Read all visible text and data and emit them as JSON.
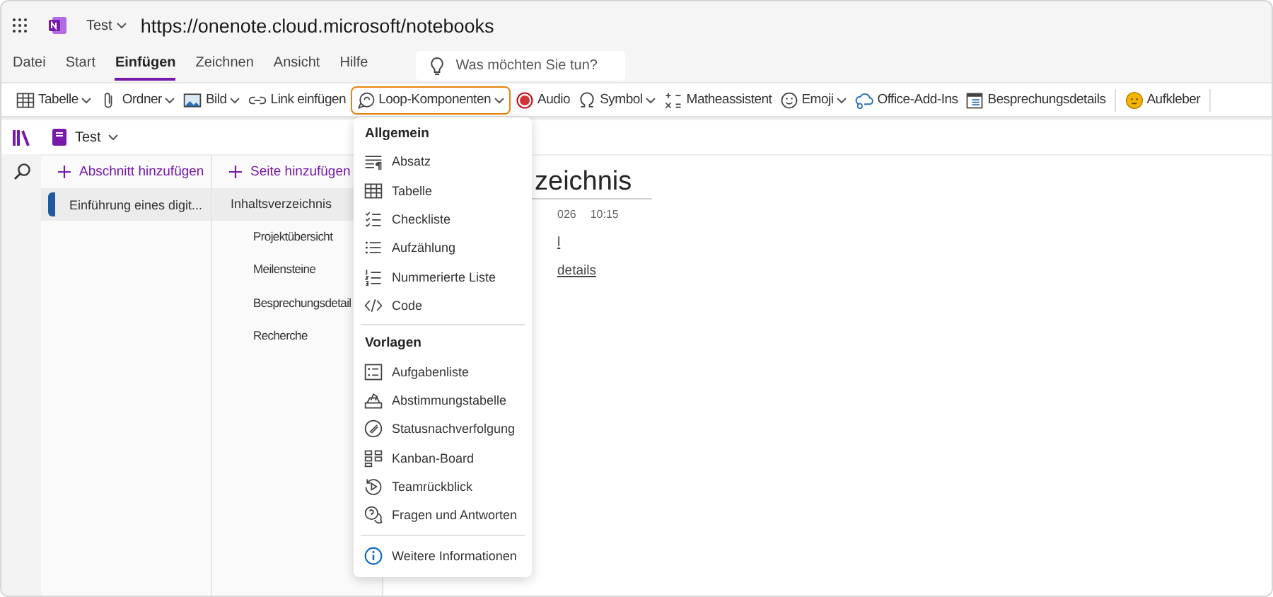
{
  "app_bar": {
    "notebook": "Test",
    "url": "https://onenote.cloud.microsoft/notebooks"
  },
  "menu_tabs": [
    {
      "label": "Datei",
      "selected": false
    },
    {
      "label": "Start",
      "selected": false
    },
    {
      "label": "Einfügen",
      "selected": true
    },
    {
      "label": "Zeichnen",
      "selected": false
    },
    {
      "label": "Ansicht",
      "selected": false
    },
    {
      "label": "Hilfe",
      "selected": false
    }
  ],
  "search": {
    "placeholder": "Was möchten Sie tun?"
  },
  "toolbar": [
    {
      "label": "Tabelle",
      "kind": "table",
      "dropdown": true,
      "open": false
    },
    {
      "label": "Ordner",
      "kind": "clip",
      "dropdown": true,
      "open": false
    },
    {
      "label": "Bild",
      "kind": "image",
      "dropdown": true,
      "open": false
    },
    {
      "label": "Link einfügen",
      "kind": "link",
      "dropdown": false,
      "open": false
    },
    {
      "label": "Loop-Komponenten",
      "kind": "loop",
      "dropdown": true,
      "open": true
    },
    {
      "label": "Audio",
      "kind": "record",
      "dropdown": false,
      "open": false
    },
    {
      "label": "Symbol",
      "kind": "omega",
      "dropdown": true,
      "open": false
    },
    {
      "label": "Matheassistent",
      "kind": "math",
      "dropdown": false,
      "open": false
    },
    {
      "label": "Emoji",
      "kind": "smile",
      "dropdown": true,
      "open": false
    },
    {
      "label": "Office-Add-Ins",
      "kind": "addin",
      "dropdown": false,
      "open": false
    },
    {
      "label": "Besprechungsdetails",
      "kind": "calendar",
      "dropdown": false,
      "open": false
    },
    {
      "label": "Aufkleber",
      "kind": "sticker",
      "dropdown": false,
      "open": false
    }
  ],
  "notebook": {
    "name": "Test"
  },
  "sections": {
    "add_label": "Abschnitt hinzufügen",
    "items": [
      {
        "label": "Einführung eines digit...",
        "selected": true,
        "color": "#1f5a9e"
      }
    ]
  },
  "pages": {
    "add_label": "Seite hinzufügen",
    "items": [
      {
        "label": "Inhaltsverzeichnis",
        "selected": true,
        "children": [
          {
            "label": "Projektübersicht",
            "selected": false
          },
          {
            "label": "Meilensteine",
            "selected": false
          },
          {
            "label": "Besprechungsdetail",
            "selected": false
          },
          {
            "label": "Recherche",
            "selected": false
          }
        ]
      }
    ]
  },
  "page": {
    "title": "zeichnis",
    "date": "026",
    "time": "10:15",
    "links": [
      "l",
      "details"
    ]
  },
  "dropdown": {
    "groups": [
      {
        "heading": "Allgemein",
        "items": [
          {
            "label": "Absatz",
            "kind": "paragraph"
          },
          {
            "label": "Tabelle",
            "kind": "table"
          },
          {
            "label": "Checkliste",
            "kind": "checklist"
          },
          {
            "label": "Aufzählung",
            "kind": "bullets"
          },
          {
            "label": "Nummerierte Liste",
            "kind": "numbered"
          },
          {
            "label": "Code",
            "kind": "code"
          }
        ]
      },
      {
        "heading": "Vorlagen",
        "items": [
          {
            "label": "Aufgabenliste",
            "kind": "tasklist"
          },
          {
            "label": "Abstimmungstabelle",
            "kind": "ballot"
          },
          {
            "label": "Statusnachverfolgung",
            "kind": "status"
          },
          {
            "label": "Kanban-Board",
            "kind": "kanban"
          },
          {
            "label": "Teamrückblick",
            "kind": "retro"
          },
          {
            "label": "Fragen und Antworten",
            "kind": "qa"
          }
        ]
      }
    ],
    "footer": {
      "label": "Weitere Informationen"
    }
  }
}
